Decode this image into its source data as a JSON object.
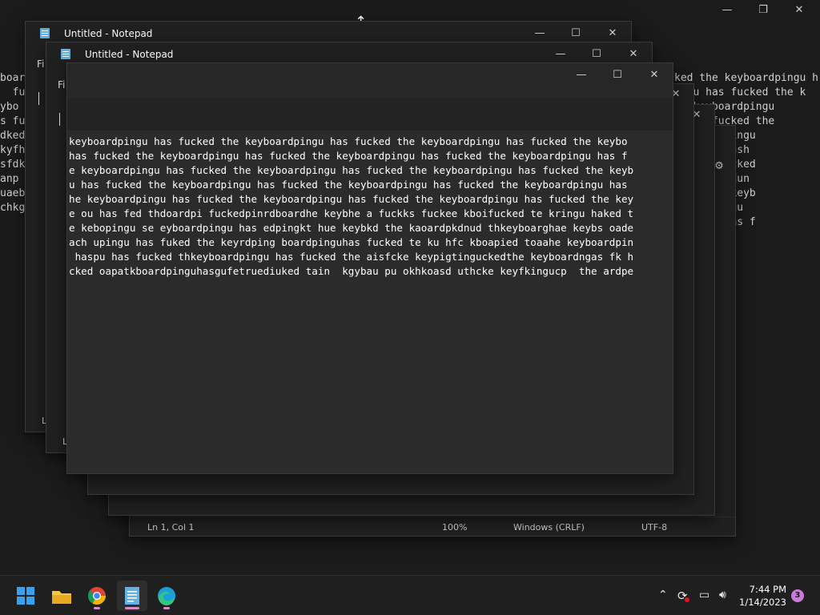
{
  "window_title": "Untitled - Notepad",
  "menu_file": "Fi",
  "status": {
    "position": "Ln 1, Col 1",
    "zoom": "100%",
    "line_ending": "Windows (CRLF)",
    "encoding": "UTF-8"
  },
  "left_bg_lines": [
    "boar",
    "  fuc",
    "ybo",
    "s fu",
    "dked",
    "kyfh",
    "sfdk",
    "anp",
    "uaeb",
    "chkg"
  ],
  "right_bg_lines": [
    "ked the keyboardpingu h",
    "ingu has fucked the k",
    "he keyboardpingu",
    "u has fucked the",
    "keyboardpingu",
    "pnu asch hsh",
    "thske ko cked",
    "kupgdecdydun",
    "cked the keyb",
    "the kdpingu",
    "rdpingu has f"
  ],
  "editor_lines": [
    "keyboardpingu has fucked the keyboardpingu has fucked the keyboardpingu has fucked the keybo",
    "has fucked the keyboardpingu has fucked the keyboardpingu has fucked the keyboardpingu has f",
    "e keyboardpingu has fucked the keyboardpingu has fucked the keyboardpingu has fucked the keyb",
    "u has fucked the keyboardpingu has fucked the keyboardpingu has fucked the keyboardpingu has",
    "he keyboardpingu has fucked the keyboardpingu has fucked the keyboardpingu has fucked the key",
    "e ou has fed thdoardpi fuckedpinrdboardhe keybhe a fuckks fuckee kboifucked te kringu haked t",
    "e kebopingu se eyboardpingu has edpingkt hue keybkd the kaoardpkdnud thkeyboarghae keybs oade",
    "ach upingu has fuked the keyrdping boardpinguhas fucked te ku hfc kboapied toaahe keyboardpin",
    " haspu has fucked thkeyboardpingu has fucked the aisfcke keypigtinguckedthe keyboardngas fk h",
    "cked oapatkboardpinguhasgufetruediuked tain  kgybau pu okhkoasd uthcke keyfkingucp  the ardpe"
  ],
  "controls": {
    "minimize": "—",
    "maximize": "☐",
    "close": "✕"
  },
  "taskbar": {
    "apps": [
      "Start",
      "File Explorer",
      "Google Chrome",
      "Notepad",
      "Microsoft Edge"
    ],
    "time": "7:44 PM",
    "date": "1/14/2023",
    "notification_count": "3"
  },
  "accent": "#5fb3e8"
}
